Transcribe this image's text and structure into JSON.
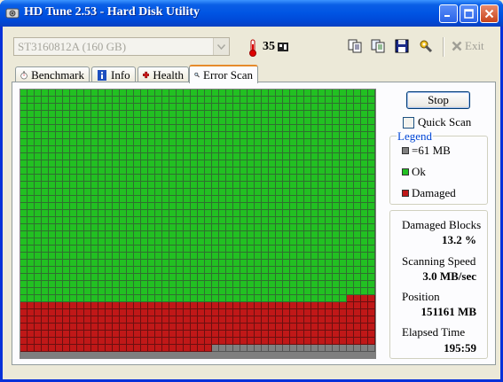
{
  "window": {
    "title": "HD Tune 2.53 - Hard Disk Utility"
  },
  "toolbar": {
    "drive": "ST3160812A (160 GB)",
    "temperature": "35",
    "exit_label": "Exit"
  },
  "tabs": [
    {
      "label": "Benchmark",
      "icon": "stopwatch-icon"
    },
    {
      "label": "Info",
      "icon": "info-icon"
    },
    {
      "label": "Health",
      "icon": "health-cross-icon"
    },
    {
      "label": "Error Scan",
      "icon": "magnifier-icon",
      "active": true
    }
  ],
  "scan": {
    "stop_label": "Stop",
    "quick_scan_label": "Quick Scan",
    "quick_scan_checked": false,
    "grid": {
      "columns": 50,
      "rows": 37,
      "ok_rows": 30,
      "damaged_from_row": 30,
      "partial_row": {
        "row": 29,
        "damaged_from_col": 46
      },
      "last_row_unscanned_from_col": 27
    }
  },
  "legend": {
    "title": "Legend",
    "items": [
      {
        "label": "=61 MB",
        "color": "#808080"
      },
      {
        "label": "Ok",
        "color": "#22c022"
      },
      {
        "label": "Damaged",
        "color": "#c01818"
      }
    ]
  },
  "stats": {
    "damaged_blocks_label": "Damaged Blocks",
    "damaged_blocks_value": "13.2 %",
    "scanning_speed_label": "Scanning Speed",
    "scanning_speed_value": "3.0 MB/sec",
    "position_label": "Position",
    "position_value": "151161 MB",
    "elapsed_label": "Elapsed Time",
    "elapsed_value": "195:59"
  },
  "colors": {
    "ok": "#22c022",
    "damaged": "#c01818",
    "unscanned": "#808080",
    "accent": "#0046d5"
  }
}
